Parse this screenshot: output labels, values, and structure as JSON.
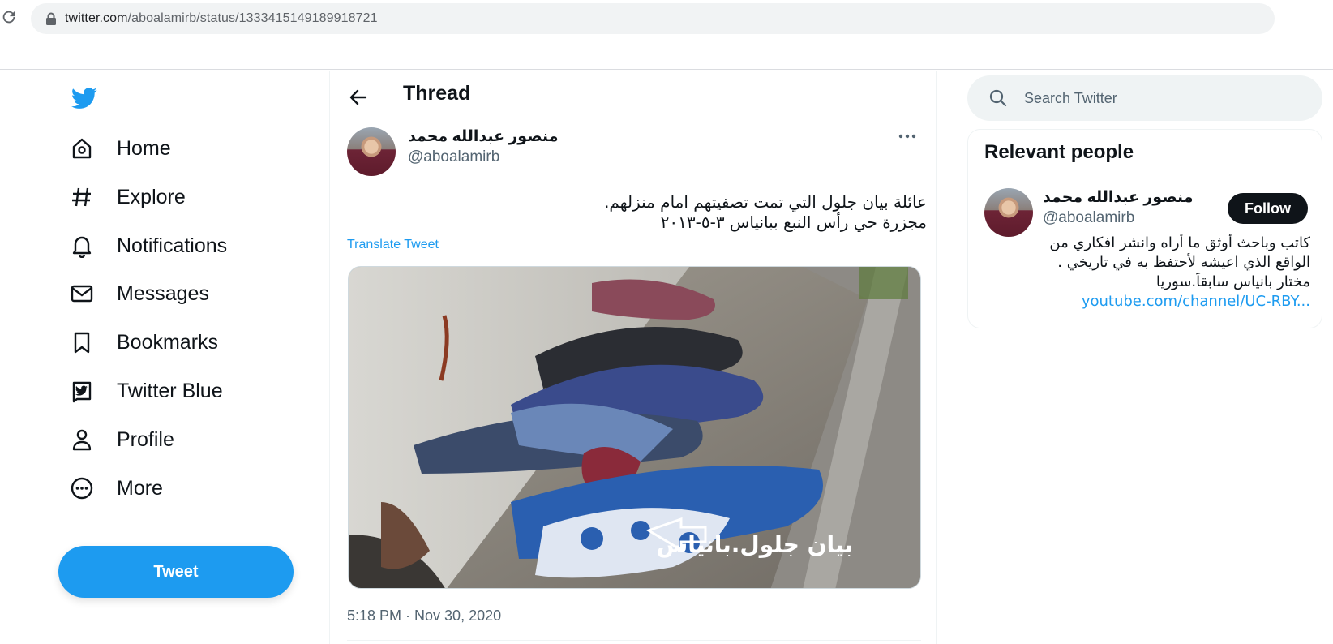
{
  "browser": {
    "url_host": "twitter.com",
    "url_path": "/aboalamirb/status/1333415149189918721"
  },
  "sidebar": {
    "items": [
      {
        "label": "Home",
        "icon": "home-icon"
      },
      {
        "label": "Explore",
        "icon": "hashtag-icon"
      },
      {
        "label": "Notifications",
        "icon": "bell-icon"
      },
      {
        "label": "Messages",
        "icon": "envelope-icon"
      },
      {
        "label": "Bookmarks",
        "icon": "bookmark-icon"
      },
      {
        "label": "Twitter Blue",
        "icon": "twitter-blue-icon"
      },
      {
        "label": "Profile",
        "icon": "person-icon"
      },
      {
        "label": "More",
        "icon": "more-circle-icon"
      }
    ],
    "tweet_button": "Tweet"
  },
  "main": {
    "title": "Thread",
    "tweet": {
      "author_name": "منصور عبدالله محمد",
      "author_handle": "@aboalamirb",
      "text_line1": "عائلة بيان جلول التي تمت تصفيتهم امام منزلهم.",
      "text_line2": "مجزرة حي رأس النبع ببانياس ٣-٥-٢٠١٣",
      "translate_label": "Translate Tweet",
      "image_caption": "بيان جلول.بانياس",
      "timestamp": "5:18 PM · Nov 30, 2020"
    }
  },
  "right": {
    "search_placeholder": "Search Twitter",
    "relevant": {
      "title": "Relevant people",
      "name": "منصور عبدالله محمد",
      "handle": "@aboalamirb",
      "follow_label": "Follow",
      "bio_line1": "كاتب وباحث أوثق ما أراه وانشر افكاري من",
      "bio_line2": "الواقع الذي اعيشه لأحتفظ به في تاريخي .",
      "bio_line3": "مختار بانياس سابقاً.سوريا",
      "bio_link": "youtube.com/channel/UC-RBY..."
    }
  },
  "colors": {
    "brand": "#1d9bf0",
    "text_primary": "#0f1419",
    "text_secondary": "#536471",
    "follow_button": "#0f1419"
  }
}
